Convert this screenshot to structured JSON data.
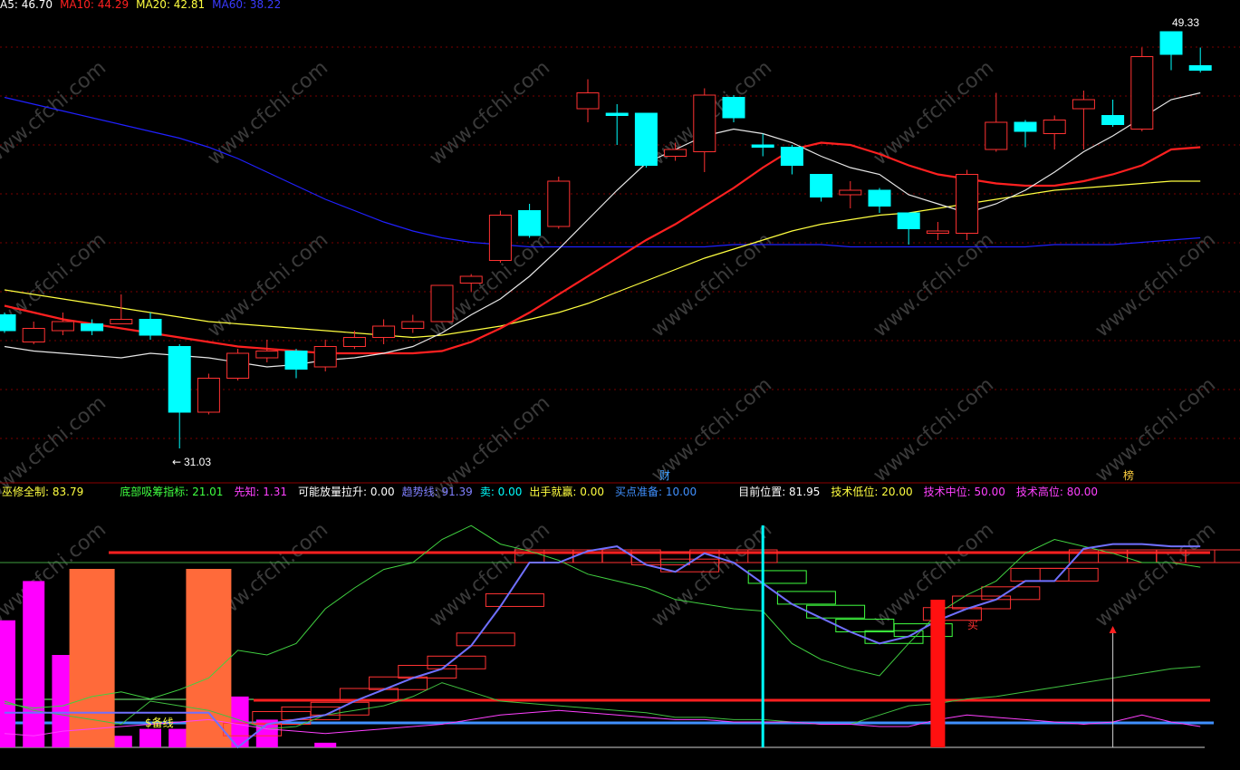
{
  "colors": {
    "background": "#000000",
    "up": "#ff3232",
    "down": "#00ffff",
    "ma5": "#e6e6e6",
    "ma10": "#ff2020",
    "ma20": "#ffff40",
    "ma60": "#2020ff",
    "grid": "#7a0000",
    "separator": "#8b0000"
  },
  "top_legend": [
    {
      "label": "A5: 46.70",
      "color": "#ffffff"
    },
    {
      "label": "MA10: 44.29",
      "color": "#ff2020"
    },
    {
      "label": "MA20: 42.81",
      "color": "#ffff40"
    },
    {
      "label": "MA60: 38.22",
      "color": "#3a3aff"
    }
  ],
  "bottom_legend": [
    {
      "label": "巫修全制: 83.79",
      "color": "#ffff40"
    },
    {
      "label": "底部吸筹指标: 21.01",
      "color": "#40ff40"
    },
    {
      "label": "先知: 1.31",
      "color": "#ff40ff"
    },
    {
      "label": "可能放量拉升: 0.00",
      "color": "#ffffff"
    },
    {
      "label": "趋势线: 91.39",
      "color": "#8080ff"
    },
    {
      "label": "卖: 0.00",
      "color": "#00ffff"
    },
    {
      "label": "出手就赢: 0.00",
      "color": "#ffff40"
    },
    {
      "label": "买点准备: 10.00",
      "color": "#4090ff"
    },
    {
      "label": "目前位置: 81.95",
      "color": "#ffffff"
    },
    {
      "label": "技术低位: 20.00",
      "color": "#ffff40"
    },
    {
      "label": "技术中位: 50.00",
      "color": "#ff40ff"
    },
    {
      "label": "技术高位: 80.00",
      "color": "#ff40ff"
    }
  ],
  "annotations": {
    "max_price": "49.33",
    "min_price": "31.03",
    "event_cai": "财",
    "event_bang": "榜",
    "label_bei": "$备线",
    "label_mai": "买"
  },
  "watermark": "www.cfchi.com",
  "chart_data": {
    "type": "candlestick",
    "price_range": [
      30,
      50
    ],
    "candles": [
      {
        "o": 36.9,
        "c": 36.2,
        "h": 37.0,
        "l": 36.1
      },
      {
        "o": 35.7,
        "c": 36.3,
        "h": 36.6,
        "l": 35.6
      },
      {
        "o": 36.2,
        "c": 36.6,
        "h": 37.0,
        "l": 36.0
      },
      {
        "o": 36.5,
        "c": 36.2,
        "h": 36.7,
        "l": 36.0
      },
      {
        "o": 36.5,
        "c": 36.7,
        "h": 37.8,
        "l": 36.5
      },
      {
        "o": 36.7,
        "c": 36.0,
        "h": 37.0,
        "l": 35.8
      },
      {
        "o": 35.5,
        "c": 32.6,
        "h": 35.6,
        "l": 31.0
      },
      {
        "o": 32.6,
        "c": 34.1,
        "h": 34.3,
        "l": 32.5
      },
      {
        "o": 34.1,
        "c": 35.2,
        "h": 35.4,
        "l": 34.0
      },
      {
        "o": 35.0,
        "c": 35.3,
        "h": 35.8,
        "l": 34.8
      },
      {
        "o": 35.3,
        "c": 34.5,
        "h": 35.4,
        "l": 34.1
      },
      {
        "o": 34.6,
        "c": 35.5,
        "h": 35.8,
        "l": 34.4
      },
      {
        "o": 35.5,
        "c": 35.9,
        "h": 36.2,
        "l": 35.4
      },
      {
        "o": 35.9,
        "c": 36.4,
        "h": 36.7,
        "l": 35.6
      },
      {
        "o": 36.3,
        "c": 36.6,
        "h": 36.9,
        "l": 36.1
      },
      {
        "o": 36.6,
        "c": 38.2,
        "h": 38.2,
        "l": 36.6
      },
      {
        "o": 38.3,
        "c": 38.6,
        "h": 38.7,
        "l": 37.9
      },
      {
        "o": 39.3,
        "c": 41.3,
        "h": 41.5,
        "l": 39.2
      },
      {
        "o": 41.5,
        "c": 40.4,
        "h": 41.8,
        "l": 40.3
      },
      {
        "o": 40.8,
        "c": 42.8,
        "h": 43.0,
        "l": 40.7
      },
      {
        "o": 46.0,
        "c": 46.7,
        "h": 47.3,
        "l": 45.4
      },
      {
        "o": 45.8,
        "c": 45.7,
        "h": 46.2,
        "l": 44.4
      },
      {
        "o": 45.8,
        "c": 43.5,
        "h": 45.8,
        "l": 43.4
      },
      {
        "o": 43.9,
        "c": 44.2,
        "h": 44.5,
        "l": 43.7
      },
      {
        "o": 44.1,
        "c": 46.6,
        "h": 46.9,
        "l": 43.2
      },
      {
        "o": 46.5,
        "c": 45.6,
        "h": 46.6,
        "l": 45.4
      },
      {
        "o": 44.4,
        "c": 44.3,
        "h": 44.9,
        "l": 43.9
      },
      {
        "o": 44.3,
        "c": 43.5,
        "h": 44.4,
        "l": 43.1
      },
      {
        "o": 43.1,
        "c": 42.1,
        "h": 43.1,
        "l": 41.9
      },
      {
        "o": 42.2,
        "c": 42.4,
        "h": 42.8,
        "l": 41.6
      },
      {
        "o": 42.4,
        "c": 41.7,
        "h": 42.5,
        "l": 41.4
      },
      {
        "o": 41.4,
        "c": 40.7,
        "h": 41.4,
        "l": 40.0
      },
      {
        "o": 40.5,
        "c": 40.6,
        "h": 41.0,
        "l": 40.2
      },
      {
        "o": 40.5,
        "c": 43.1,
        "h": 43.3,
        "l": 40.2
      },
      {
        "o": 44.2,
        "c": 45.4,
        "h": 46.7,
        "l": 44.1
      },
      {
        "o": 45.4,
        "c": 45.0,
        "h": 45.5,
        "l": 44.3
      },
      {
        "o": 44.9,
        "c": 45.5,
        "h": 45.7,
        "l": 44.2
      },
      {
        "o": 46.0,
        "c": 46.4,
        "h": 46.8,
        "l": 44.2
      },
      {
        "o": 45.7,
        "c": 45.3,
        "h": 46.4,
        "l": 45.2
      },
      {
        "o": 45.1,
        "c": 48.3,
        "h": 48.7,
        "l": 45.0
      },
      {
        "o": 49.4,
        "c": 48.4,
        "h": 49.4,
        "l": 47.7
      },
      {
        "o": 47.9,
        "c": 47.7,
        "h": 48.7,
        "l": 47.6
      }
    ],
    "ma5": [
      35.5,
      35.3,
      35.2,
      35.1,
      35.0,
      35.2,
      35.1,
      35.0,
      34.8,
      34.6,
      34.7,
      34.9,
      35.0,
      35.2,
      35.5,
      36.1,
      36.9,
      37.6,
      38.6,
      39.8,
      41.1,
      42.4,
      43.6,
      44.2,
      44.8,
      45.1,
      44.9,
      44.5,
      43.9,
      43.4,
      43.1,
      42.2,
      41.8,
      41.4,
      41.8,
      42.4,
      43.2,
      44.1,
      44.8,
      45.6,
      46.4,
      46.7
    ],
    "ma10": [
      37.3,
      37.0,
      36.7,
      36.5,
      36.3,
      36.1,
      35.9,
      35.7,
      35.5,
      35.4,
      35.3,
      35.2,
      35.2,
      35.2,
      35.2,
      35.3,
      35.7,
      36.3,
      37.0,
      37.8,
      38.6,
      39.4,
      40.2,
      40.9,
      41.7,
      42.5,
      43.4,
      44.2,
      44.5,
      44.4,
      44.0,
      43.5,
      43.1,
      42.9,
      42.7,
      42.6,
      42.6,
      42.8,
      43.1,
      43.5,
      44.2,
      44.3
    ],
    "ma20": [
      38.0,
      37.8,
      37.6,
      37.4,
      37.2,
      37.0,
      36.8,
      36.6,
      36.5,
      36.4,
      36.3,
      36.2,
      36.1,
      36.0,
      35.9,
      36.0,
      36.2,
      36.4,
      36.7,
      37.0,
      37.4,
      37.9,
      38.4,
      38.9,
      39.4,
      39.8,
      40.2,
      40.6,
      40.9,
      41.1,
      41.3,
      41.4,
      41.6,
      41.8,
      42.0,
      42.2,
      42.4,
      42.5,
      42.6,
      42.7,
      42.8,
      42.8
    ],
    "ma60": [
      46.5,
      46.2,
      45.9,
      45.6,
      45.3,
      45.0,
      44.7,
      44.3,
      43.8,
      43.2,
      42.6,
      42.0,
      41.5,
      41.0,
      40.6,
      40.3,
      40.1,
      40.0,
      39.9,
      39.9,
      39.9,
      39.9,
      39.9,
      39.9,
      39.9,
      40.0,
      40.0,
      40.0,
      40.0,
      39.9,
      39.9,
      39.9,
      39.9,
      39.9,
      39.9,
      39.9,
      40.0,
      40.0,
      40.0,
      40.1,
      40.2,
      40.3
    ],
    "indicator": {
      "range": [
        0,
        100
      ],
      "levels": {
        "tech_low": 20,
        "tech_mid": 50,
        "tech_high": 80,
        "buy_prep": 10
      },
      "trend_line": [
        0,
        0,
        0,
        0,
        0,
        0,
        0,
        0,
        0,
        10,
        12,
        14,
        20,
        25,
        30,
        34,
        44,
        61,
        80,
        80,
        85,
        87,
        79,
        76,
        84,
        80,
        71,
        62,
        56,
        50,
        45,
        48,
        55,
        60,
        64,
        72,
        72,
        86,
        88,
        88,
        87,
        87
      ],
      "absorb_line": [
        19,
        17,
        18,
        22,
        24,
        21,
        25,
        30,
        42,
        40,
        45,
        60,
        69,
        77,
        80,
        90,
        96,
        88,
        85,
        81,
        75,
        72,
        69,
        64,
        62,
        60,
        59,
        45,
        38,
        34,
        31,
        45,
        58,
        66,
        72,
        84,
        90,
        87,
        84,
        80,
        80,
        78
      ],
      "low_green": [
        20,
        16,
        14,
        12,
        10,
        20,
        18,
        16,
        12,
        8,
        9,
        14,
        16,
        18,
        22,
        28,
        24,
        20,
        19,
        18,
        17,
        16,
        15,
        13,
        13,
        12,
        12,
        11,
        10,
        10,
        14,
        18,
        19,
        21,
        22,
        24,
        26,
        28,
        30,
        32,
        34,
        35
      ],
      "magenta_line": [
        6,
        5,
        7,
        8,
        9,
        10,
        11,
        12,
        10,
        8,
        7,
        6,
        7,
        8,
        9,
        10,
        12,
        14,
        15,
        16,
        15,
        14,
        13,
        12,
        12,
        11,
        11,
        11,
        10,
        10,
        9,
        9,
        12,
        14,
        13,
        12,
        11,
        10,
        11,
        14,
        11,
        9
      ],
      "magenta_bars": [
        55,
        72,
        40,
        20,
        5,
        8,
        8,
        30,
        22,
        12,
        0,
        2,
        0,
        0,
        0,
        0,
        0,
        0,
        0,
        0,
        0,
        0,
        0,
        0,
        0,
        0,
        0,
        0,
        0,
        0,
        0,
        0,
        0,
        0,
        0,
        0,
        0,
        0,
        0,
        0,
        0,
        0
      ],
      "orange_bars_at": [
        3,
        7
      ],
      "red_signal_at": 32,
      "cyan_marker_at": 26,
      "arrow_at": 38
    }
  }
}
